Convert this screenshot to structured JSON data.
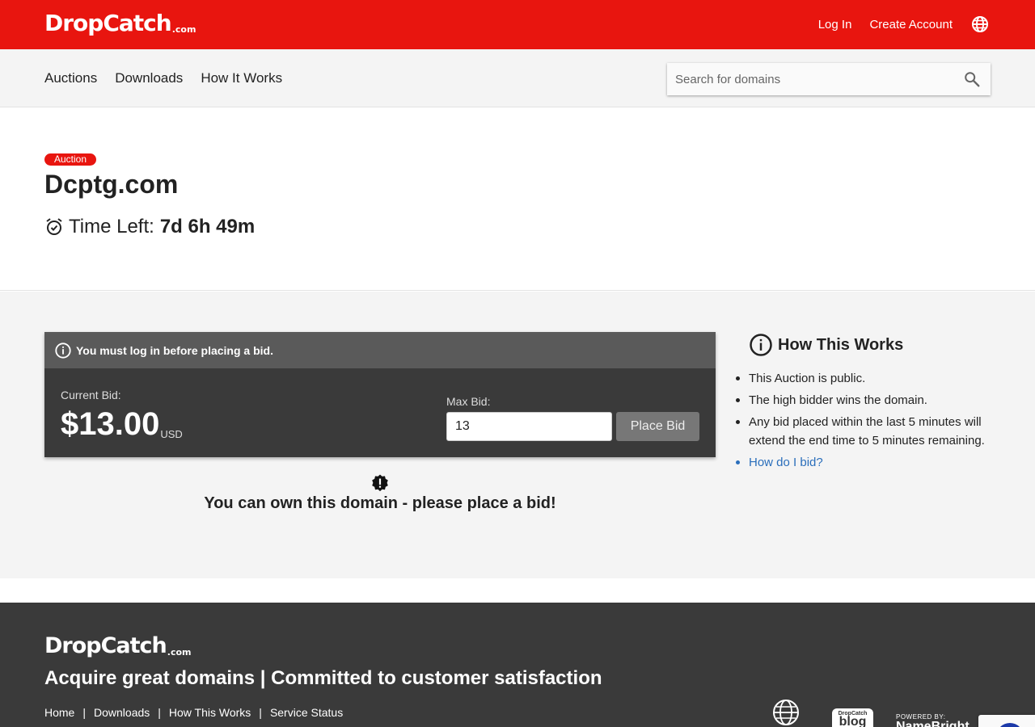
{
  "header": {
    "logo_main": "DropCatch",
    "logo_tld": ".com",
    "login": "Log In",
    "create_account": "Create Account"
  },
  "nav": {
    "items": [
      "Auctions",
      "Downloads",
      "How It Works"
    ],
    "search_placeholder": "Search for domains"
  },
  "domain": {
    "badge": "Auction",
    "name": "Dcptg.com",
    "time_left_label": "Time Left:",
    "time_left_value": "7d 6h 49m"
  },
  "bid": {
    "alert": "You must log in before placing a bid.",
    "current_bid_label": "Current Bid:",
    "current_bid_amount": "$13.00",
    "currency": "USD",
    "max_bid_label": "Max Bid:",
    "max_bid_value": "13",
    "place_bid_label": "Place Bid",
    "own_message": "You can own this domain - please place a bid!"
  },
  "how_works": {
    "title": "How This Works",
    "items": [
      "This Auction is public.",
      "The high bidder wins the domain.",
      "Any bid placed within the last 5 minutes will extend the end time to 5 minutes remaining.",
      "How do I bid?"
    ]
  },
  "footer": {
    "logo_main": "DropCatch",
    "logo_tld": ".com",
    "tagline": "Acquire great domains | Committed to customer satisfaction",
    "links": [
      "Home",
      "Downloads",
      "How This Works",
      "Service Status"
    ],
    "separator": "|",
    "blog_small": "DropCatch",
    "blog_big": "blog",
    "powered_by": "POWERED BY:",
    "powered_name": "NameBright"
  },
  "colors": {
    "brand_red": "#e8150f",
    "dark_panel": "#3a3a3a",
    "link_blue": "#2a6ebb"
  }
}
